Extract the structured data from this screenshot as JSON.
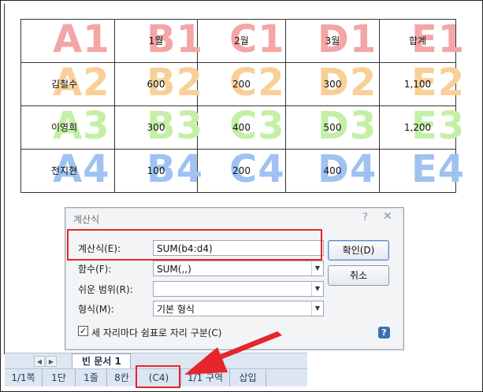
{
  "table": {
    "rows": [
      {
        "cells": [
          {
            "watermark": "A1",
            "text": ""
          },
          {
            "watermark": "B1",
            "text": "1월"
          },
          {
            "watermark": "C1",
            "text": "2월"
          },
          {
            "watermark": "D1",
            "text": "3월"
          },
          {
            "watermark": "E1",
            "text": "합계"
          }
        ]
      },
      {
        "cells": [
          {
            "watermark": "A2",
            "text": "김철수"
          },
          {
            "watermark": "B2",
            "text": "600"
          },
          {
            "watermark": "C2",
            "text": "200"
          },
          {
            "watermark": "D2",
            "text": "300"
          },
          {
            "watermark": "E2",
            "text": "1,100"
          }
        ]
      },
      {
        "cells": [
          {
            "watermark": "A3",
            "text": "이영희"
          },
          {
            "watermark": "B3",
            "text": "300"
          },
          {
            "watermark": "C3",
            "text": "400"
          },
          {
            "watermark": "D3",
            "text": "500"
          },
          {
            "watermark": "E3",
            "text": "1,200"
          }
        ]
      },
      {
        "cells": [
          {
            "watermark": "A4",
            "text": "전지현"
          },
          {
            "watermark": "B4",
            "text": "100"
          },
          {
            "watermark": "C4",
            "text": "200"
          },
          {
            "watermark": "D4",
            "text": "400"
          },
          {
            "watermark": "E4",
            "text": ""
          }
        ]
      }
    ],
    "watermark_colors": [
      "#f4a5a5",
      "#f9cf98",
      "#c3f0a4",
      "#9fc2f0"
    ]
  },
  "dialog": {
    "title": "계산식",
    "help_icon": "?",
    "close_icon": "✕",
    "formula_label": "계산식(E):",
    "formula_value": "SUM(b4:d4)",
    "function_label": "함수(F):",
    "function_value": "SUM(,,)",
    "range_label": "쉬운 범위(R):",
    "range_value": "",
    "format_label": "형식(M):",
    "format_value": "기본 형식",
    "checkbox_label": "세 자리마다 쉼표로 자리 구분(C)",
    "checkbox_checked": "✓",
    "ok_label": "확인(D)",
    "cancel_label": "취소",
    "help_button": "?"
  },
  "tabs": {
    "doc_tab": "빈 문서 1"
  },
  "status": {
    "page": "1/1쪽",
    "column": "1단",
    "line": "1줄",
    "char": "8칸",
    "cell": "(C4)",
    "section": "1/1 구역",
    "mode": "삽입"
  },
  "colors": {
    "highlight": "#e5262a",
    "status_bg": "#dce6f2",
    "dialog_bg": "#f3f4f6"
  }
}
